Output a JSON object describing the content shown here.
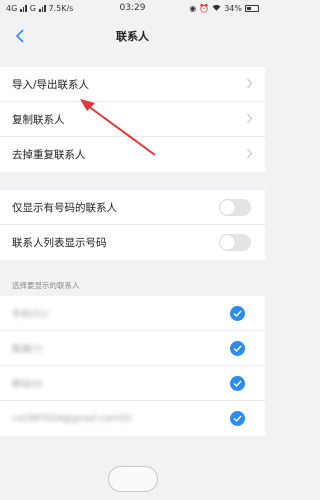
{
  "status_bar": {
    "left": "4G",
    "carrier2": "G",
    "speed": "7.5K/s",
    "time": "03:29",
    "battery": "34%"
  },
  "nav": {
    "title": "联系人",
    "back_icon": "chevron-left-icon"
  },
  "menu_items": [
    {
      "label": "导入/导出联系人"
    },
    {
      "label": "复制联系人"
    },
    {
      "label": "去掉重复联系人"
    }
  ],
  "toggles": [
    {
      "label": "仅显示有号码的联系人",
      "checked": false
    },
    {
      "label": "联系人列表显示号码",
      "checked": false
    }
  ],
  "accounts_section": {
    "title": "选择要显示的联系人",
    "items": [
      {
        "label": "手机(51)",
        "checked": true
      },
      {
        "label": "联通(7)",
        "checked": true
      },
      {
        "label": "移动(0)",
        "checked": true
      },
      {
        "label": "ca1997024@gmail.com(0)",
        "checked": true
      }
    ]
  },
  "colors": {
    "accent": "#2d8cf0",
    "annotation_arrow": "#e8373a"
  }
}
